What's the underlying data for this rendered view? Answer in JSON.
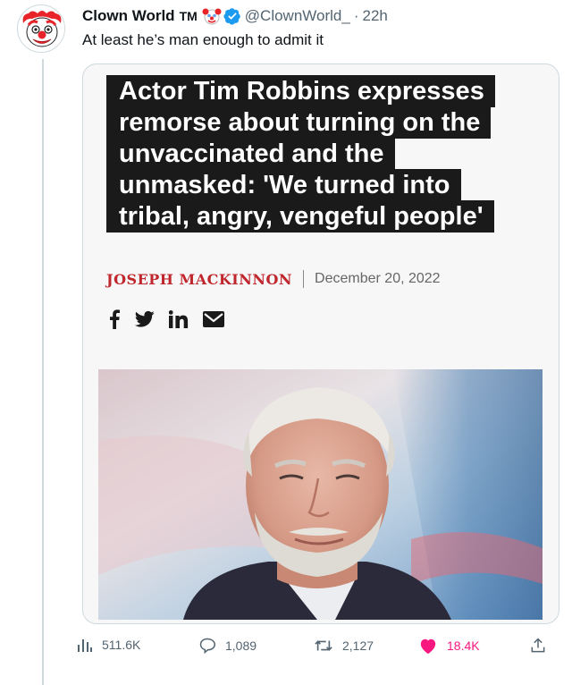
{
  "tweet": {
    "author_name": "Clown World",
    "trademark": "TM",
    "handle": "@ClownWorld_",
    "separator": "·",
    "time": "22h",
    "text": "At least he’s man enough to admit it"
  },
  "article": {
    "headline_lines": [
      "Actor Tim Robbins expresses",
      "remorse about turning on the",
      "unvaccinated and the",
      "unmasked: 'We turned into",
      "tribal, angry, vengeful people'"
    ],
    "author": "JOSEPH MACKINNON",
    "date": "December 20, 2022",
    "share_icons": [
      "facebook-icon",
      "twitter-icon",
      "linkedin-icon",
      "email-icon"
    ]
  },
  "actions": {
    "views": "511.6K",
    "replies": "1,089",
    "retweets": "2,127",
    "likes": "18.4K"
  },
  "colors": {
    "verified": "#1d9bf0",
    "like": "#f91880",
    "author_red": "#c0272d",
    "headline_bg": "#1a1a1a"
  }
}
